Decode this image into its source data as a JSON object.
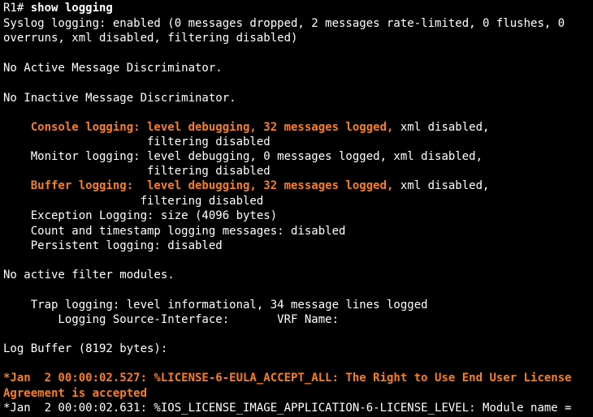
{
  "colors": {
    "background": "#000000",
    "text": "#ffffff",
    "highlight": "#f57f22"
  },
  "prompt": "R1# ",
  "command": "show logging",
  "syslog_line1": "Syslog logging: enabled (0 messages dropped, 2 messages rate-limited, 0 flushes, 0",
  "syslog_line2": "overruns, xml disabled, filtering disabled)",
  "active_discriminator": "No Active Message Discriminator.",
  "inactive_discriminator": "No Inactive Message Discriminator.",
  "console": {
    "highlighted": "    Console logging: level debugging, 32 messages logged,",
    "rest": " xml disabled,",
    "cont": "                     filtering disabled"
  },
  "monitor": {
    "line1": "    Monitor logging: level debugging, 0 messages logged, xml disabled,",
    "cont": "                     filtering disabled"
  },
  "buffer": {
    "highlighted": "    Buffer logging:  level debugging, 32 messages logged,",
    "rest": " xml disabled,",
    "cont": "                    filtering disabled"
  },
  "exception_logging": "    Exception Logging: size (4096 bytes)",
  "count_timestamp": "    Count and timestamp logging messages: disabled",
  "persistent_logging": "    Persistent logging: disabled",
  "filter_modules": "No active filter modules.",
  "trap_logging": "    Trap logging: level informational, 34 message lines logged",
  "source_interface": "        Logging Source-Interface:       VRF Name:",
  "log_buffer": "Log Buffer (8192 bytes):",
  "log1_line1": "*Jan  2 00:00:02.527: %LICENSE-6-EULA_ACCEPT_ALL: The Right to Use End User License",
  "log1_line2": "Agreement is accepted",
  "log2_line1": "*Jan  2 00:00:02.631: %IOS_LICENSE_IMAGE_APPLICATION-6-LICENSE_LEVEL: Module name ="
}
